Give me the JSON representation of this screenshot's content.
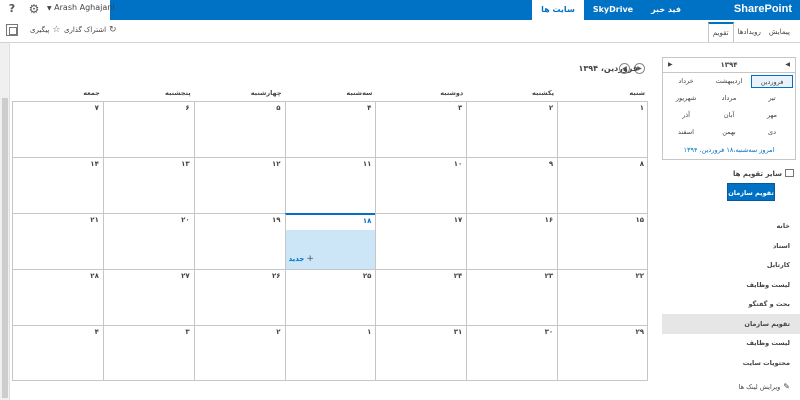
{
  "suitebar": {
    "brand": "SharePoint",
    "tabs": [
      {
        "label": "فید خبر",
        "active": false
      },
      {
        "label": "SkyDrive",
        "active": false
      },
      {
        "label": "سایت ها",
        "active": true
      }
    ],
    "user": "Arash Aghajani",
    "help": "?"
  },
  "commands": {
    "share": "اشتراک گذاری",
    "follow": "پیگیری"
  },
  "ribbon": {
    "tabs": [
      "پیمایش",
      "رویدادها",
      "تقویم"
    ]
  },
  "calendar": {
    "title": "فروردین، ۱۳۹۴",
    "weekdays": [
      "شنبه",
      "یکشنبه",
      "دوشنبه",
      "سه‌شنبه",
      "چهارشنبه",
      "پنجشنبه",
      "جمعه"
    ],
    "weeks": [
      [
        "۱",
        "۲",
        "۳",
        "۴",
        "۵",
        "۶",
        "۷"
      ],
      [
        "۸",
        "۹",
        "۱۰",
        "۱۱",
        "۱۲",
        "۱۳",
        "۱۴"
      ],
      [
        "۱۵",
        "۱۶",
        "۱۷",
        "۱۸",
        "۱۹",
        "۲۰",
        "۲۱"
      ],
      [
        "۲۲",
        "۲۳",
        "۲۴",
        "۲۵",
        "۲۶",
        "۲۷",
        "۲۸"
      ],
      [
        "۲۹",
        "۳۰",
        "۳۱",
        "۱",
        "۲",
        "۳",
        "۴"
      ]
    ],
    "today_week": 2,
    "today_day": 3,
    "new_label": "جدید"
  },
  "picker": {
    "year": "۱۳۹۴",
    "months": [
      [
        "فروردین",
        "اردیبهشت",
        "خرداد"
      ],
      [
        "تیر",
        "مرداد",
        "شهریور"
      ],
      [
        "مهر",
        "آبان",
        "آذر"
      ],
      [
        "دی",
        "بهمن",
        "اسفند"
      ]
    ],
    "selected_month": "فروردین",
    "today_text": "امروز سه‌شنبه،۱۸ فروردین، ۱۳۹۴"
  },
  "other_calendars": {
    "label": "سایر تقویم ها",
    "button": "تقویم سازمان"
  },
  "quicklaunch": {
    "items": [
      "خانه",
      "اسناد",
      "کارتابل",
      "لیست وظایف",
      "بحث و گفتگو",
      "تقویم سازمان",
      "لیست وظایف",
      "محتویات سایت"
    ],
    "selected_index": 5
  },
  "edit_links": "ویرایش لینک ها",
  "colors": {
    "accent": "#0072c6",
    "today_fill": "#cde6f7",
    "grid": "#c6c6c6"
  }
}
